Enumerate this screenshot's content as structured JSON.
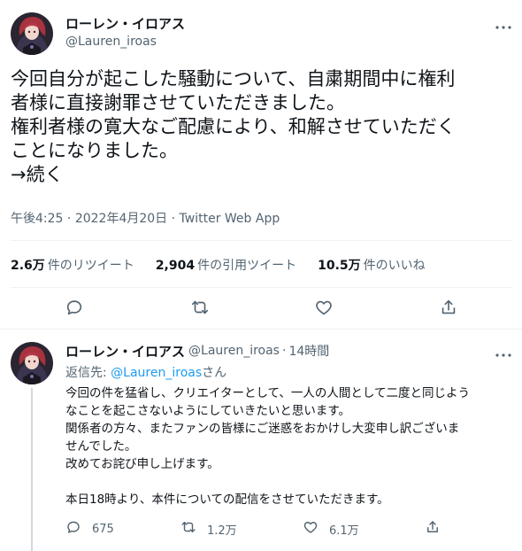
{
  "main_tweet": {
    "author_name": "ローレン・イロアス",
    "author_handle": "@Lauren_iroas",
    "text": "今回自分が起こした騒動について、自粛期間中に権利\n者様に直接謝罪させていただきました。\n権利者様の寛大なご配慮により、和解させていただく\nことになりました。\n→続く",
    "time": "午後4:25",
    "date": "2022年4月20日",
    "separator": "·",
    "app": "Twitter Web App",
    "stats": [
      {
        "value": "2.6万",
        "label": "件のリツイート"
      },
      {
        "value": "2,904",
        "label": "件の引用ツイート"
      },
      {
        "value": "10.5万",
        "label": "件のいいね"
      }
    ],
    "actions": [
      "reply-icon",
      "retweet-icon",
      "like-icon",
      "share-icon"
    ]
  },
  "reply_tweet": {
    "author_name": "ローレン・イロアス",
    "author_handle": "@Lauren_iroas",
    "separator": "·",
    "time": "14時間",
    "replying_prefix": "返信先: ",
    "replying_to": "@Lauren_iroas",
    "replying_suffix": "さん",
    "text": "今回の件を猛省し、クリエイターとして、一人の人間として二度と同じよう\nなことを起こさないようにしていきたいと思います。\n関係者の方々、またファンの皆様にご迷惑をおかけし大変申し訳ございま\nせんでした。\n改めてお詫び申し上げます。\n\n本日18時より、本件についての配信をさせていただきます。",
    "reply_count": "675",
    "retweet_count": "1.2万",
    "like_count": "6.1万"
  },
  "colors": {
    "text": "#0f1419",
    "secondary": "#536471",
    "link": "#1d9bf0",
    "border": "#eff3f4",
    "thread_line": "#cfd9de"
  }
}
